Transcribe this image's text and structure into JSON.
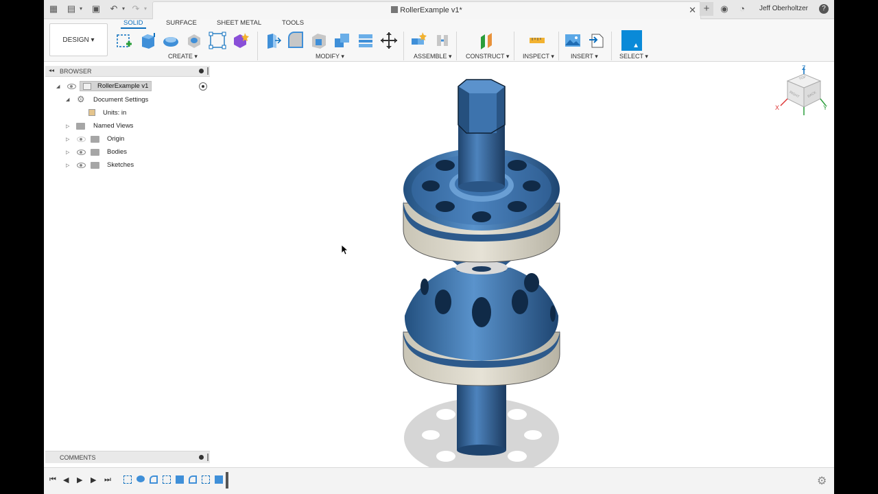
{
  "window": {
    "document_title": "RollerExample v1*",
    "user_name": "Jeff Oberholtzer"
  },
  "toolbar": {
    "workspace_label": "DESIGN",
    "tabs": [
      "SOLID",
      "SURFACE",
      "SHEET METAL",
      "TOOLS"
    ],
    "active_tab": "SOLID",
    "groups": [
      "CREATE",
      "MODIFY",
      "ASSEMBLE",
      "CONSTRUCT",
      "INSPECT",
      "INSERT",
      "SELECT"
    ]
  },
  "browser": {
    "header": "BROWSER",
    "root": "RollerExample v1",
    "items": [
      {
        "label": "Document Settings"
      },
      {
        "label": "Units: in"
      },
      {
        "label": "Named Views"
      },
      {
        "label": "Origin"
      },
      {
        "label": "Bodies"
      },
      {
        "label": "Sketches"
      }
    ]
  },
  "comments": {
    "header": "COMMENTS"
  },
  "viewcube": {
    "face_front": "RIGHT",
    "face_side": "BACK",
    "face_top": "TOP",
    "axis_z": "Z",
    "axis_x": "X",
    "axis_y": "Y"
  },
  "colors": {
    "accent": "#0a6ebd",
    "body_blue": "#2d5a8c",
    "band_beige": "#d4d0c4"
  }
}
